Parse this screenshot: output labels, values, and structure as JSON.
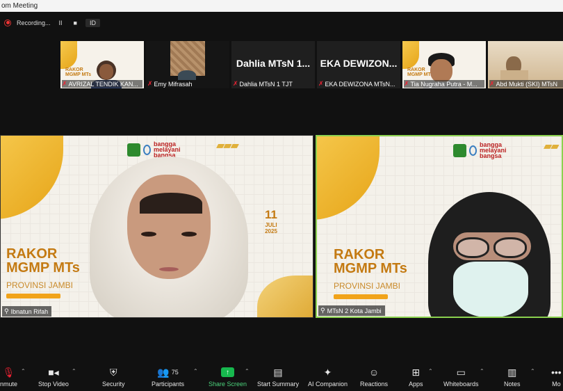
{
  "window": {
    "title": "om Meeting"
  },
  "recording": {
    "status": "Recording...",
    "pause": "II",
    "stop": "■",
    "id": "ID"
  },
  "thumbnails": [
    {
      "name": "AVRIZAL TENDIK KAN...",
      "type": "slide"
    },
    {
      "name": "Emy Mifrasah",
      "type": "camera"
    },
    {
      "name": "Dahlia MTsN 1 TJT",
      "bigname": "Dahlia MTsN 1...",
      "type": "text"
    },
    {
      "name": "EKA DEWIZONA MTsN...",
      "bigname": "EKA DEWIZON...",
      "type": "text"
    },
    {
      "name": "Tia Nugraha Putra - M...",
      "type": "slide"
    },
    {
      "name": "Abd Mukti (SKI) MTsN",
      "type": "desert"
    }
  ],
  "tiles": [
    {
      "name": "Ibnatun Rifah",
      "slide": {
        "title1": "RAKOR",
        "title2": "MGMP MTs",
        "province": "PROVINSI JAMBI",
        "day": "11",
        "month": "JULI",
        "year": "2025",
        "brand": "bangga melayani bangsa"
      }
    },
    {
      "name": "MTsN 2 Kota Jambi",
      "slide": {
        "title1": "RAKOR",
        "title2": "MGMP MTs",
        "province": "PROVINSI JAMBI",
        "brand": "bangga melayani bangsa"
      }
    }
  ],
  "toolbar": {
    "unmute": "nmute",
    "stop_video": "Stop Video",
    "security": "Security",
    "participants": "Participants",
    "participants_count": "75",
    "share_screen": "Share Screen",
    "start_summary": "Start Summary",
    "ai_companion": "AI Companion",
    "reactions": "Reactions",
    "apps": "Apps",
    "whiteboards": "Whiteboards",
    "notes": "Notes",
    "more": "Mo"
  },
  "colors": {
    "accent_share": "#17b84e",
    "active_speaker_border": "#8bd14f",
    "muted_mic": "#e23"
  }
}
